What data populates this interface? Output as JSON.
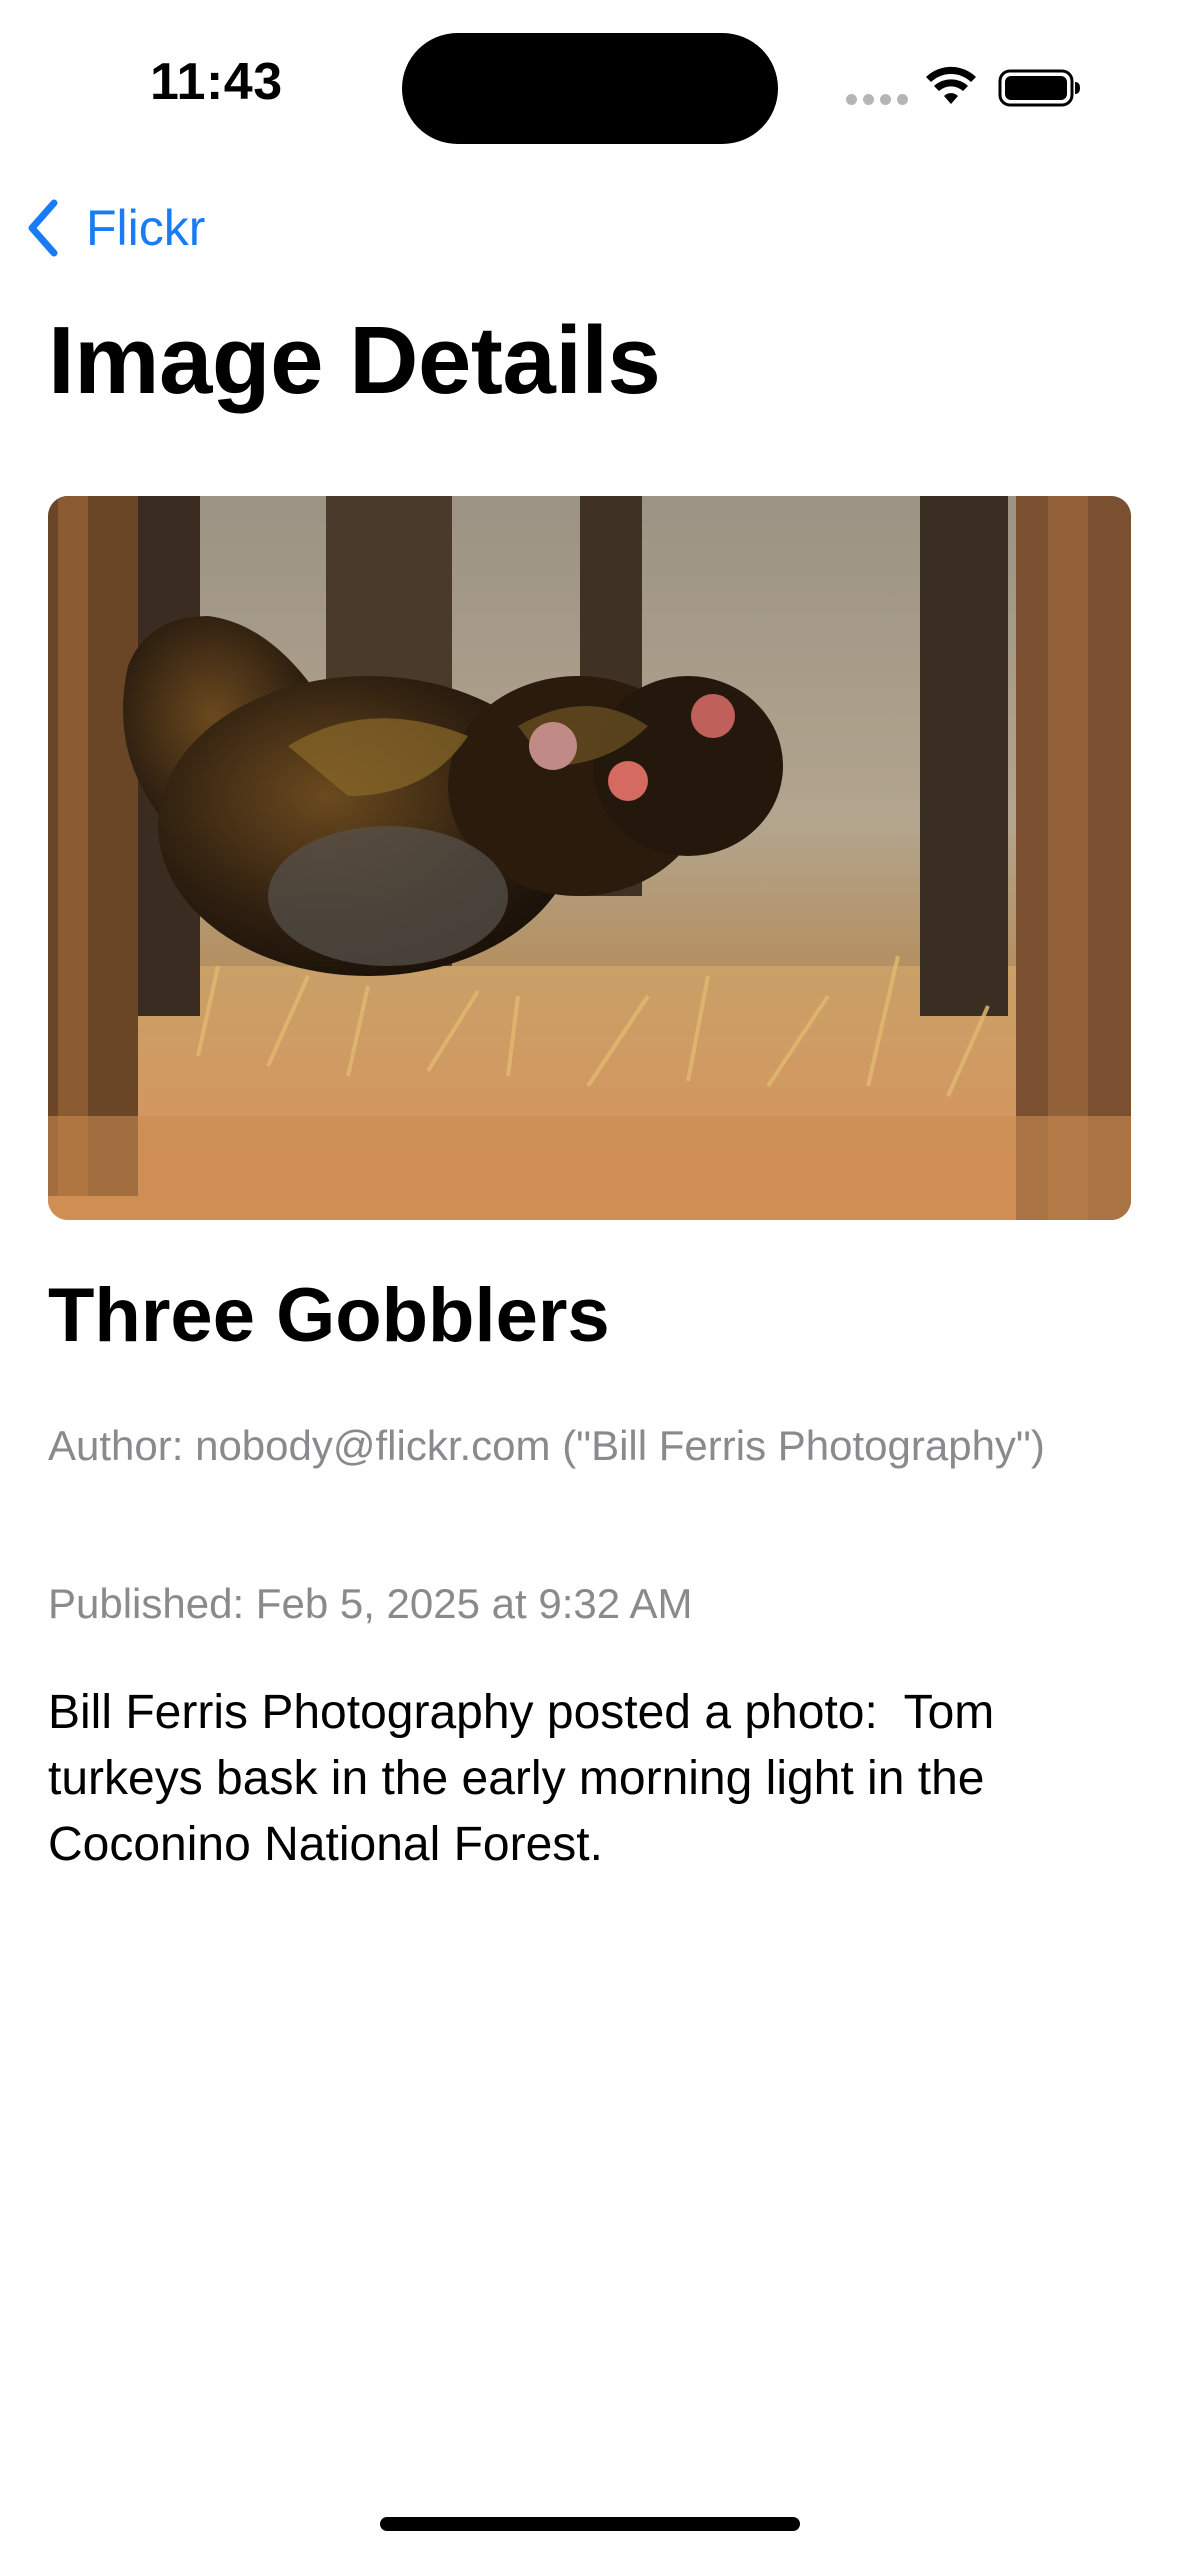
{
  "status_bar": {
    "time": "11:43"
  },
  "nav": {
    "back_label": "Flickr",
    "back_icon": "chevron-left-icon",
    "accent_color": "#1a7cf5"
  },
  "page": {
    "title": "Image Details"
  },
  "image": {
    "description": "photo of turkeys in forest"
  },
  "details": {
    "title": "Three Gobblers",
    "author": "Author: nobody@flickr.com (\"Bill Ferris Photography\")",
    "published": "Published: Feb 5, 2025 at 9:32 AM",
    "description": "Bill Ferris Photography posted a photo:  Tom turkeys bask in the early morning light in the Coconino National Forest."
  }
}
